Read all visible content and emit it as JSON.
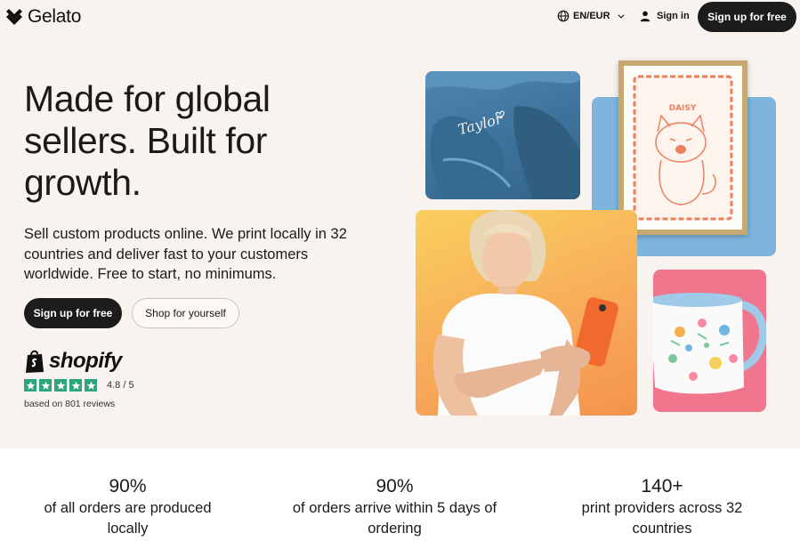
{
  "header": {
    "brand": "Gelato",
    "language": "EN/EUR",
    "signin": "Sign in",
    "signup": "Sign up for free"
  },
  "hero": {
    "title": "Made for global sellers. Built for growth.",
    "subtitle": "Sell custom products online. We print locally in 32 countries and deliver fast to your customers worldwide. Free to start, no minimums.",
    "primary_button": "Sign up for free",
    "secondary_button": "Shop for yourself"
  },
  "trust": {
    "brand": "shopify",
    "rating_value": 4.8,
    "stars": 5,
    "rating_text": "4.8 / 5",
    "reviews": "based on 801 reviews"
  },
  "images": {
    "sweatshirt_text": "Taylor",
    "print_text": "DAISY"
  },
  "stats": [
    {
      "value": "90%",
      "label": "of all orders are produced locally"
    },
    {
      "value": "90%",
      "label": "of orders arrive within 5 days of ordering"
    },
    {
      "value": "140+",
      "label": "print providers across 32 countries"
    }
  ],
  "colors": {
    "background": "#f8f3ee",
    "button": "#1c1c1c",
    "star": "#2ea67d"
  }
}
